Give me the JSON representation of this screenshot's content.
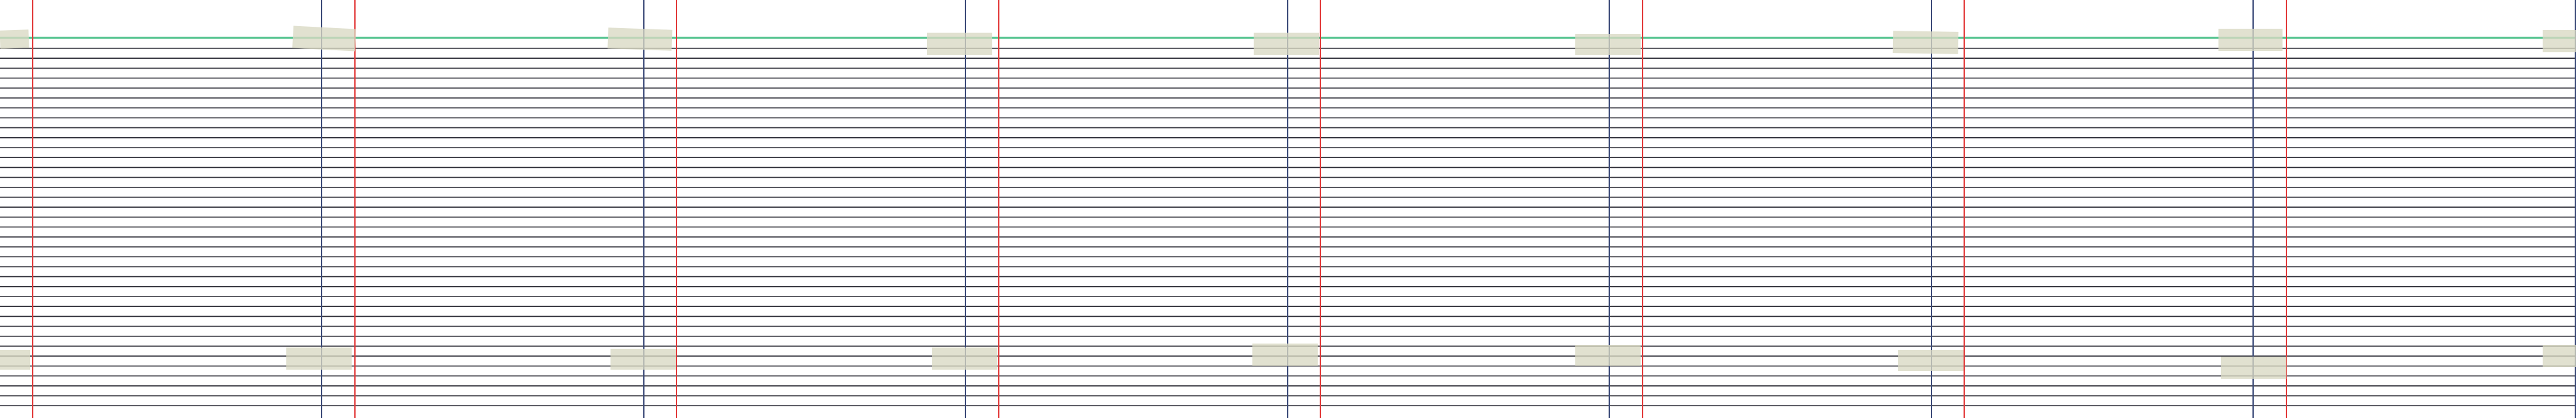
{
  "scene": {
    "description_kind": "panoramic-notebook-paper-strip",
    "page_count": 8,
    "colors": {
      "paper": "#ffffff",
      "ruled_line": "#2b2b35",
      "top_header_line": "#4fc28b",
      "margin_line": "#e23a3a",
      "page_edge": "#3b4a78",
      "tape": "#d8d8c3"
    }
  }
}
